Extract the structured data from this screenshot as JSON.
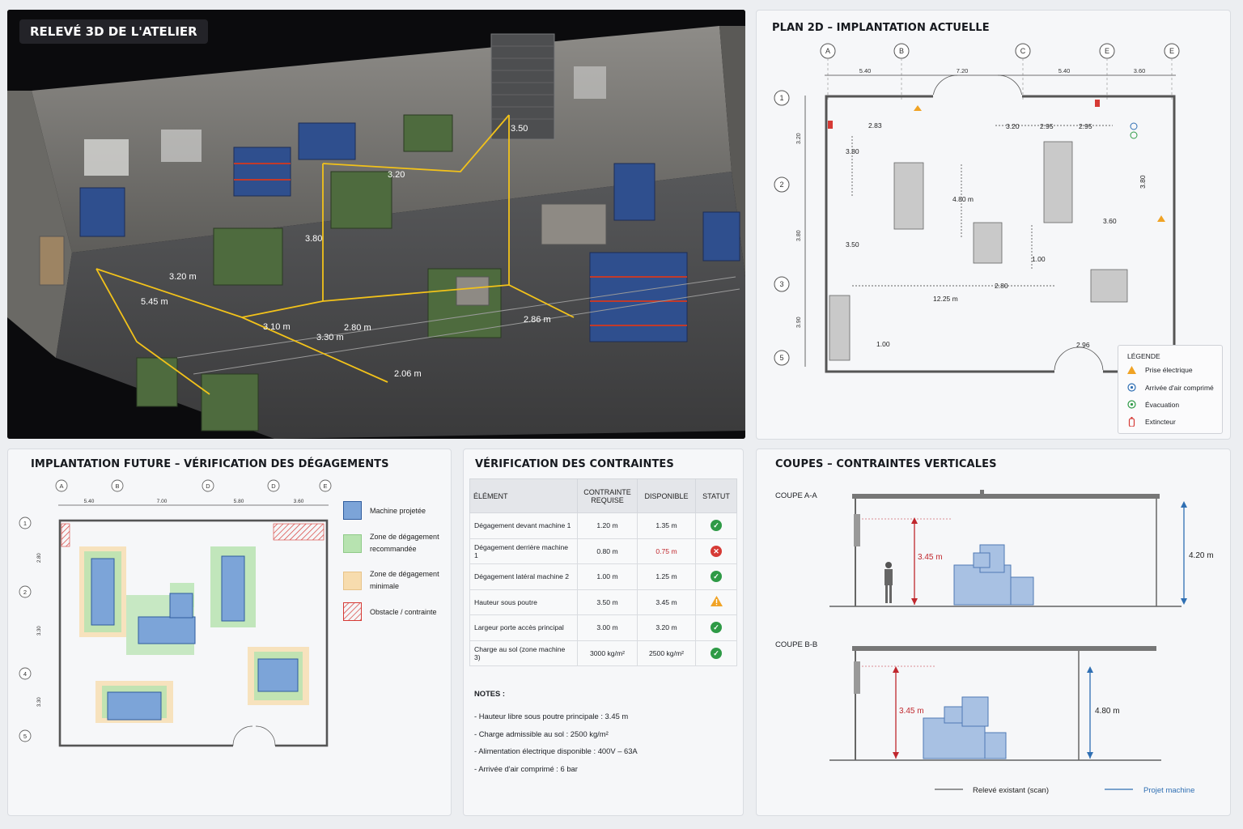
{
  "scan_panel": {
    "badge": "RELEVÉ 3D DE L'ATELIER",
    "dims": [
      "3.20 m",
      "5.45 m",
      "3.20",
      "2.06 m",
      "2.86 m",
      "3.10 m",
      "3.30 m",
      "2.80 m",
      "3.80",
      "3.50"
    ]
  },
  "plan2d": {
    "title": "PLAN 2D – IMPLANTATION ACTUELLE",
    "col_axes": [
      "A",
      "B",
      "C",
      "E",
      "E"
    ],
    "col_dims": [
      "5.40",
      "7.20",
      "5.40",
      "3.60"
    ],
    "row_axes": [
      "1",
      "2",
      "3",
      "5"
    ],
    "row_dims": [
      "3.20",
      "3.80",
      "3.90"
    ],
    "inner_dims": {
      "d1": "2.83",
      "d2": "3.20",
      "d3": "2.95",
      "d4": "2.95",
      "d5": "3.80",
      "d6": "4.80 m",
      "d7": "3.50",
      "d8": "2.80",
      "d9": "12.25 m",
      "d10": "3.80",
      "d11": "1.00",
      "d12": "2.96",
      "d13": "1.00",
      "d14": "3.60"
    },
    "legend": {
      "title": "LÉGENDE",
      "items": [
        {
          "label": "Prise électrique",
          "icon": "warning-triangle-icon",
          "color": "#f0a325"
        },
        {
          "label": "Arrivée d'air comprimé",
          "icon": "target-icon",
          "color": "#2f6fb3"
        },
        {
          "label": "Évacuation",
          "icon": "circle-dot-icon",
          "color": "#2e9a46"
        },
        {
          "label": "Extincteur",
          "icon": "extinguisher-icon",
          "color": "#d63a35"
        }
      ]
    }
  },
  "future": {
    "title": "IMPLANTATION FUTURE – VÉRIFICATION DES DÉGAGEMENTS",
    "col_axes": [
      "A",
      "B",
      "D",
      "D",
      "E"
    ],
    "col_dims": [
      "5.40",
      "7.00",
      "5.80",
      "3.60"
    ],
    "row_axes": [
      "1",
      "2",
      "4",
      "5"
    ],
    "row_dims": [
      "2.80",
      "3.30",
      "3.30"
    ],
    "legend": [
      {
        "label": "Machine projetée",
        "color": "#6d93cc"
      },
      {
        "label": "Zone de dégagement recommandée",
        "color": "#b7e3b0"
      },
      {
        "label": "Zone de dégagement minimale",
        "color": "#f7dcae"
      },
      {
        "label": "Obstacle / contrainte",
        "color": "#d63a35"
      }
    ]
  },
  "constraints": {
    "title": "VÉRIFICATION DES CONTRAINTES",
    "headers": [
      "ÉLÉMENT",
      "CONTRAINTE REQUISE",
      "DISPONIBLE",
      "STATUT"
    ],
    "rows": [
      {
        "element": "Dégagement devant machine 1",
        "required": "1.20 m",
        "available": "1.35 m",
        "status": "ok"
      },
      {
        "element": "Dégagement derrière machine 1",
        "required": "0.80 m",
        "available": "0.75 m",
        "status": "ko"
      },
      {
        "element": "Dégagement latéral machine 2",
        "required": "1.00 m",
        "available": "1.25 m",
        "status": "ok"
      },
      {
        "element": "Hauteur sous poutre",
        "required": "3.50 m",
        "available": "3.45 m",
        "status": "warn"
      },
      {
        "element": "Largeur porte accès principal",
        "required": "3.00 m",
        "available": "3.20 m",
        "status": "ok"
      },
      {
        "element": "Charge au sol (zone machine 3)",
        "required": "3000 kg/m²",
        "available": "2500 kg/m²",
        "status": "ok"
      }
    ],
    "notes_title": "NOTES :",
    "notes": [
      "- Hauteur libre sous poutre principale : 3.45 m",
      "- Charge admissible au sol : 2500 kg/m²",
      "- Alimentation électrique disponible : 400V – 63A",
      "- Arrivée d'air comprimé : 6 bar"
    ]
  },
  "coupes": {
    "title": "COUPES – CONTRAINTES VERTICALES",
    "aa_label": "COUPE A-A",
    "aa_clear": "3.45 m",
    "aa_total": "4.20 m",
    "bb_label": "COUPE B-B",
    "bb_clear": "3.45 m",
    "bb_total": "4.80 m",
    "legend_existing": "Relevé existant (scan)",
    "legend_project": "Projet machine"
  }
}
